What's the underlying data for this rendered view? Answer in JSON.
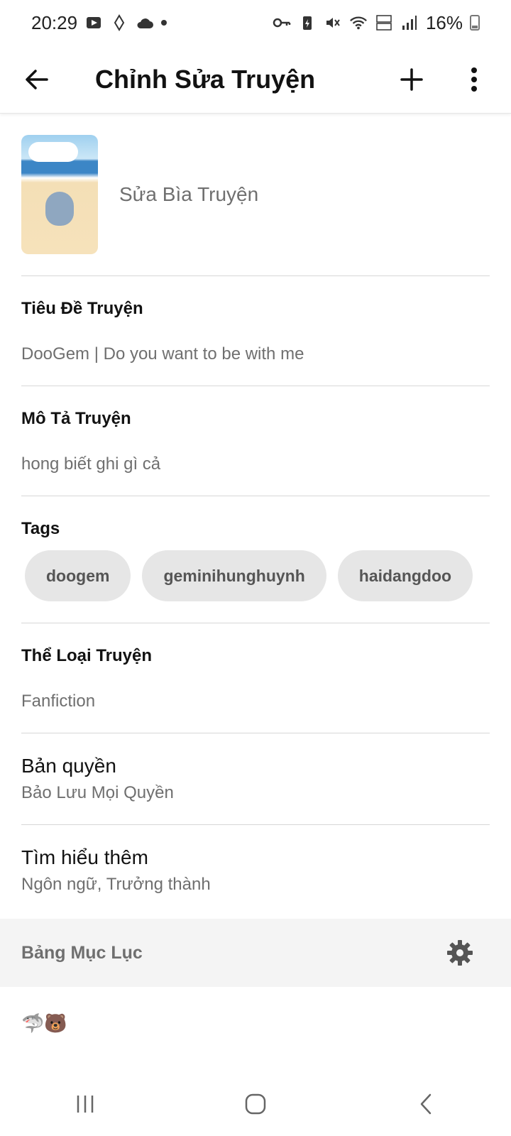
{
  "status": {
    "time": "20:29",
    "battery": "16%"
  },
  "appbar": {
    "title": "Chỉnh Sửa Truyện"
  },
  "cover": {
    "edit_label": "Sửa Bìa Truyện"
  },
  "story": {
    "title_label": "Tiêu Đề Truyện",
    "title_value": "DooGem | Do you want to be with me",
    "desc_label": "Mô Tả Truyện",
    "desc_value": "hong biết ghi gì cả",
    "tags_label": "Tags",
    "tags": [
      "doogem",
      "geminihunghuynh",
      "haidangdoo"
    ],
    "category_label": "Thể Loại Truyện",
    "category_value": "Fanfiction",
    "copyright_title": "Bản quyền",
    "copyright_value": "Bảo Lưu Mọi Quyền",
    "more_title": "Tìm hiểu thêm",
    "more_value": "Ngôn ngữ, Trưởng thành"
  },
  "toc": {
    "title": "Bảng Mục Lục"
  },
  "emoji_row": "🦈🐻",
  "icons": {
    "back": "arrow-left-icon",
    "add": "plus-icon",
    "more": "more-vertical-icon",
    "settings": "gear-icon"
  }
}
